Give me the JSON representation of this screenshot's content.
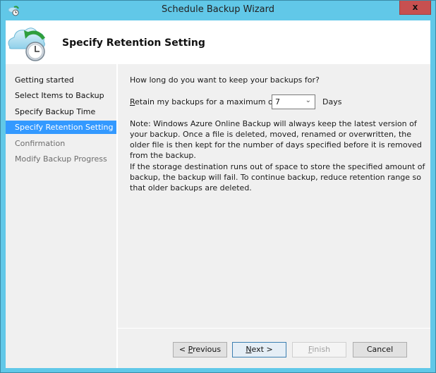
{
  "window": {
    "title": "Schedule Backup Wizard",
    "close_label": "x",
    "app_icon": "cloud-backup-clock-icon"
  },
  "header": {
    "title": "Specify Retention Setting",
    "icon": "cloud-backup-clock-icon"
  },
  "sidebar": {
    "items": [
      {
        "label": "Getting started",
        "state": "normal"
      },
      {
        "label": "Select Items to Backup",
        "state": "normal"
      },
      {
        "label": "Specify Backup Time",
        "state": "normal"
      },
      {
        "label": "Specify Retention Setting",
        "state": "active"
      },
      {
        "label": "Confirmation",
        "state": "disabled"
      },
      {
        "label": "Modify Backup Progress",
        "state": "disabled"
      }
    ]
  },
  "content": {
    "question": "How long do you want to keep your backups for?",
    "retain_label_accel": "R",
    "retain_label_rest": "etain my backups for a maximum of",
    "retention_days_value": "7",
    "days_label": "Days",
    "note": "Note: Windows Azure Online Backup will always keep the latest version of your backup. Once a file is deleted, moved, renamed or overwritten, the older file is then kept for the number of days specified before it is removed from the backup.",
    "warning": "If the storage destination runs out of space to store the specified amount of backup, the backup will fail. To continue backup, reduce retention range so that older backups are deleted."
  },
  "buttons": {
    "previous_prefix": "< ",
    "previous_accel": "P",
    "previous_rest": "revious",
    "next_accel": "N",
    "next_rest": "ext >",
    "finish_accel": "F",
    "finish_rest": "inish",
    "cancel": "Cancel"
  }
}
